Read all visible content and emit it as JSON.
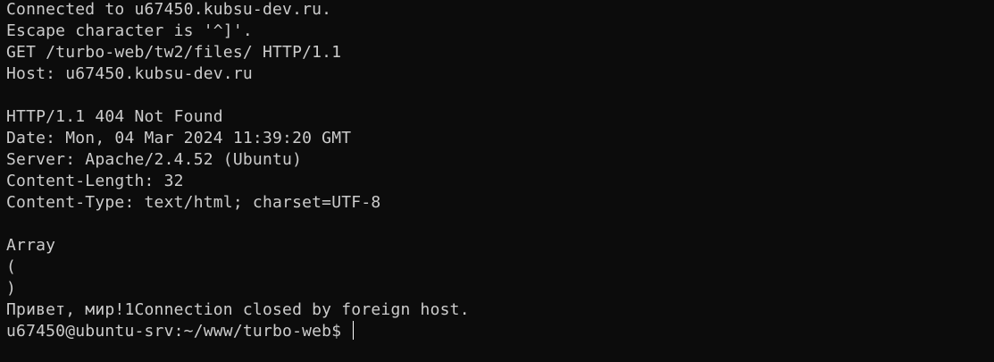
{
  "terminal": {
    "lines": [
      "Connected to u67450.kubsu-dev.ru.",
      "Escape character is '^]'.",
      "GET /turbo-web/tw2/files/ HTTP/1.1",
      "Host: u67450.kubsu-dev.ru",
      "",
      "HTTP/1.1 404 Not Found",
      "Date: Mon, 04 Mar 2024 11:39:20 GMT",
      "Server: Apache/2.4.52 (Ubuntu)",
      "Content-Length: 32",
      "Content-Type: text/html; charset=UTF-8",
      "",
      "Array",
      "(",
      ")",
      "Привет, мир!1Connection closed by foreign host."
    ],
    "prompt": "u67450@ubuntu-srv:~/www/turbo-web$ ",
    "colors": {
      "background": "#0c0c0c",
      "foreground": "#cccccc",
      "cursor": "#ffffff"
    }
  }
}
